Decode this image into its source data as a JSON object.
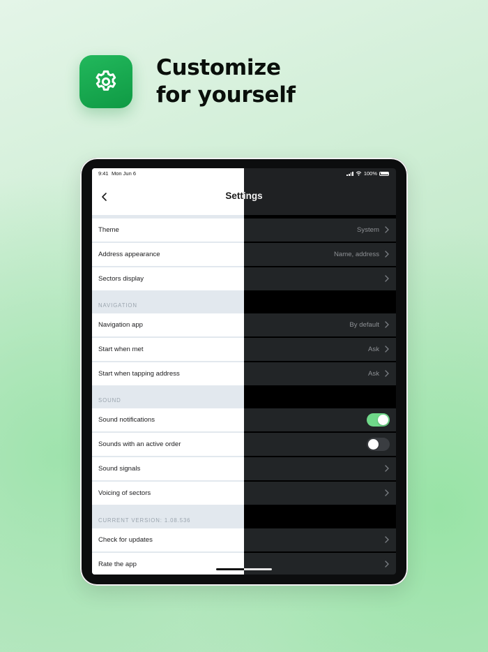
{
  "hero": {
    "line1": "Customize",
    "line2": "for yourself",
    "icon": "gear-icon",
    "icon_color": "#16a74f"
  },
  "status_bar": {
    "time": "9:41",
    "date": "Mon Jun 6",
    "battery": "100%"
  },
  "settings": {
    "title": "Settings",
    "rows": {
      "theme": {
        "label": "Theme",
        "value": "System"
      },
      "address_appearance": {
        "label": "Address appearance",
        "value": "Name, address"
      },
      "sectors_display": {
        "label": "Sectors display"
      },
      "navigation_app": {
        "label": "Navigation app",
        "value": "By default"
      },
      "start_when_met": {
        "label": "Start when met",
        "value": "Ask"
      },
      "start_when_tapping": {
        "label": "Start when tapping address",
        "value": "Ask"
      },
      "sound_notifications": {
        "label": "Sound notifications",
        "toggle": true
      },
      "sounds_active_order": {
        "label": "Sounds with an active order",
        "toggle": false
      },
      "sound_signals": {
        "label": "Sound signals"
      },
      "voicing_of_sectors": {
        "label": "Voicing of sectors"
      },
      "check_updates": {
        "label": "Check for updates"
      },
      "rate_app": {
        "label": "Rate the app"
      }
    },
    "sections": {
      "navigation": "NAVIGATION",
      "sound": "SOUND",
      "version": "CURRENT VERSION: 1.08.536"
    }
  },
  "colors": {
    "accent_green": "#6fd889",
    "dark_row": "#222527",
    "light_section_bg": "#e2e8ee"
  }
}
